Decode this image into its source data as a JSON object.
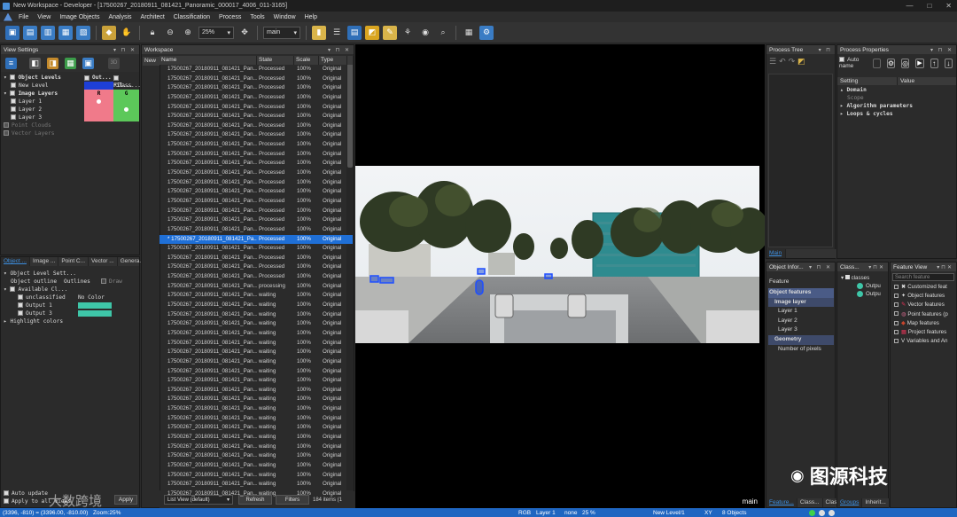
{
  "window": {
    "title": "New Workspace - Developer - [17500267_20180911_081421_Panoramic_000017_4006_011-3165]",
    "buttons": [
      "—",
      "□",
      "✕"
    ]
  },
  "menu": [
    "File",
    "View",
    "Image Objects",
    "Analysis",
    "Architect",
    "Classification",
    "Process",
    "Tools",
    "Window",
    "Help"
  ],
  "toolbar": {
    "zoom": "25%",
    "map": "main"
  },
  "view_settings": {
    "title": "View Settings",
    "tree": [
      {
        "label": "Object Levels",
        "bold": true,
        "indent": 0
      },
      {
        "label": "New Level",
        "bold": false,
        "indent": 1
      },
      {
        "label": "Image Layers",
        "bold": true,
        "indent": 0
      },
      {
        "label": "Layer 1",
        "bold": false,
        "indent": 1
      },
      {
        "label": "Layer 2",
        "bold": false,
        "indent": 1
      },
      {
        "label": "Layer 3",
        "bold": false,
        "indent": 1
      },
      {
        "label": "Point Clouds",
        "bold": false,
        "indent": 0,
        "dim": true
      },
      {
        "label": "Vector Layers",
        "bold": false,
        "indent": 0,
        "dim": true
      }
    ],
    "col_headers": [
      "Out...",
      "Fil..."
    ],
    "class_label": "Class...",
    "layer_r": "R",
    "layer_g": "G",
    "badge": "3D"
  },
  "lower_tabs": [
    "Object ...",
    "Image ...",
    "Point C...",
    "Vector ...",
    "Genera..."
  ],
  "object_level_settings": {
    "title": "Object Level Sett...",
    "outline_label": "Object outline",
    "outlines": "Outlines",
    "draw": "Draw",
    "available": "Available Cl...",
    "classes": [
      {
        "label": "unclassified",
        "color_label": "No Color",
        "color": ""
      },
      {
        "label": "Output 1",
        "color_label": "",
        "color": "#3ec6a8"
      },
      {
        "label": "Output 3",
        "color_label": "",
        "color": "#3ec6a8"
      }
    ],
    "highlight": "Highlight colors",
    "auto_update": "Auto update",
    "apply_all": "Apply to all views",
    "apply": "Apply"
  },
  "workspace": {
    "title": "Workspace",
    "root": "New",
    "columns": [
      "Name",
      "State",
      "Scale",
      "Type"
    ],
    "rows": [
      {
        "name": "17500267_20180911_081421_Pan...",
        "state": "Processed",
        "scale": "100%",
        "type": "Original"
      },
      {
        "name": "17500267_20180911_081421_Pan...",
        "state": "Processed",
        "scale": "100%",
        "type": "Original"
      },
      {
        "name": "17500267_20180911_081421_Pan...",
        "state": "Processed",
        "scale": "100%",
        "type": "Original"
      },
      {
        "name": "17500267_20180911_081421_Pan...",
        "state": "Processed",
        "scale": "100%",
        "type": "Original"
      },
      {
        "name": "17500267_20180911_081421_Pan...",
        "state": "Processed",
        "scale": "100%",
        "type": "Original"
      },
      {
        "name": "17500267_20180911_081421_Pan...",
        "state": "Processed",
        "scale": "100%",
        "type": "Original"
      },
      {
        "name": "17500267_20180911_081421_Pan...",
        "state": "Processed",
        "scale": "100%",
        "type": "Original"
      },
      {
        "name": "17500267_20180911_081421_Pan...",
        "state": "Processed",
        "scale": "100%",
        "type": "Original"
      },
      {
        "name": "17500267_20180911_081421_Pan...",
        "state": "Processed",
        "scale": "100%",
        "type": "Original"
      },
      {
        "name": "17500267_20180911_081421_Pan...",
        "state": "Processed",
        "scale": "100%",
        "type": "Original"
      },
      {
        "name": "17500267_20180911_081421_Pan...",
        "state": "Processed",
        "scale": "100%",
        "type": "Original"
      },
      {
        "name": "17500267_20180911_081421_Pan...",
        "state": "Processed",
        "scale": "100%",
        "type": "Original"
      },
      {
        "name": "17500267_20180911_081421_Pan...",
        "state": "Processed",
        "scale": "100%",
        "type": "Original"
      },
      {
        "name": "17500267_20180911_081421_Pan...",
        "state": "Processed",
        "scale": "100%",
        "type": "Original"
      },
      {
        "name": "17500267_20180911_081421_Pan...",
        "state": "Processed",
        "scale": "100%",
        "type": "Original"
      },
      {
        "name": "17500267_20180911_081421_Pan...",
        "state": "Processed",
        "scale": "100%",
        "type": "Original"
      },
      {
        "name": "17500267_20180911_081421_Pan...",
        "state": "Processed",
        "scale": "100%",
        "type": "Original"
      },
      {
        "name": "17500267_20180911_081421_Pan...",
        "state": "Processed",
        "scale": "100%",
        "type": "Original"
      },
      {
        "name": "* 17500267_20180911_081421_Pa...",
        "state": "Processed",
        "scale": "100%",
        "type": "Original",
        "selected": true
      },
      {
        "name": "17500267_20180911_081421_Pan...",
        "state": "Processed",
        "scale": "100%",
        "type": "Original"
      },
      {
        "name": "17500267_20180911_081421_Pan...",
        "state": "Processed",
        "scale": "100%",
        "type": "Original"
      },
      {
        "name": "17500267_20180911_081421_Pan...",
        "state": "Processed",
        "scale": "100%",
        "type": "Original"
      },
      {
        "name": "17500267_20180911_081421_Pan...",
        "state": "Processed",
        "scale": "100%",
        "type": "Original"
      },
      {
        "name": "17500267_20180911_081421_Pan...",
        "state": "processing",
        "scale": "100%",
        "type": "Original"
      },
      {
        "name": "17500267_20180911_081421_Pan...",
        "state": "waiting",
        "scale": "100%",
        "type": "Original"
      },
      {
        "name": "17500267_20180911_081421_Pan...",
        "state": "waiting",
        "scale": "100%",
        "type": "Original"
      },
      {
        "name": "17500267_20180911_081421_Pan...",
        "state": "waiting",
        "scale": "100%",
        "type": "Original"
      },
      {
        "name": "17500267_20180911_081421_Pan...",
        "state": "waiting",
        "scale": "100%",
        "type": "Original"
      },
      {
        "name": "17500267_20180911_081421_Pan...",
        "state": "waiting",
        "scale": "100%",
        "type": "Original"
      },
      {
        "name": "17500267_20180911_081421_Pan...",
        "state": "waiting",
        "scale": "100%",
        "type": "Original"
      },
      {
        "name": "17500267_20180911_081421_Pan...",
        "state": "waiting",
        "scale": "100%",
        "type": "Original"
      },
      {
        "name": "17500267_20180911_081421_Pan...",
        "state": "waiting",
        "scale": "100%",
        "type": "Original"
      },
      {
        "name": "17500267_20180911_081421_Pan...",
        "state": "waiting",
        "scale": "100%",
        "type": "Original"
      },
      {
        "name": "17500267_20180911_081421_Pan...",
        "state": "waiting",
        "scale": "100%",
        "type": "Original"
      },
      {
        "name": "17500267_20180911_081421_Pan...",
        "state": "waiting",
        "scale": "100%",
        "type": "Original"
      },
      {
        "name": "17500267_20180911_081421_Pan...",
        "state": "waiting",
        "scale": "100%",
        "type": "Original"
      },
      {
        "name": "17500267_20180911_081421_Pan...",
        "state": "waiting",
        "scale": "100%",
        "type": "Original"
      },
      {
        "name": "17500267_20180911_081421_Pan...",
        "state": "waiting",
        "scale": "100%",
        "type": "Original"
      },
      {
        "name": "17500267_20180911_081421_Pan...",
        "state": "waiting",
        "scale": "100%",
        "type": "Original"
      },
      {
        "name": "17500267_20180911_081421_Pan...",
        "state": "waiting",
        "scale": "100%",
        "type": "Original"
      },
      {
        "name": "17500267_20180911_081421_Pan...",
        "state": "waiting",
        "scale": "100%",
        "type": "Original"
      },
      {
        "name": "17500267_20180911_081421_Pan...",
        "state": "waiting",
        "scale": "100%",
        "type": "Original"
      },
      {
        "name": "17500267_20180911_081421_Pan...",
        "state": "waiting",
        "scale": "100%",
        "type": "Original"
      },
      {
        "name": "17500267_20180911_081421_Pan...",
        "state": "waiting",
        "scale": "100%",
        "type": "Original"
      },
      {
        "name": "17500267_20180911_081421_Pan...",
        "state": "waiting",
        "scale": "100%",
        "type": "Original"
      },
      {
        "name": "17500267_20180911_081421_Pan...",
        "state": "waiting",
        "scale": "100%",
        "type": "Original"
      }
    ],
    "view_mode": "List View (default)",
    "refresh": "Refresh",
    "filters": "Filters",
    "count": "184 items (1"
  },
  "viewer": {
    "label": "main"
  },
  "process_tree": {
    "title": "Process Tree",
    "tab": "Main"
  },
  "process_properties": {
    "title": "Process Properties",
    "auto_name": "Auto name",
    "col_setting": "Setting",
    "col_value": "Value",
    "items": [
      "Domain",
      "Scope",
      "Algorithm parameters",
      "Loops & cycles"
    ]
  },
  "object_info": {
    "title": "Object Infor...",
    "header": "Feature",
    "items": [
      {
        "label": "Object features",
        "style": "section"
      },
      {
        "label": "Image layer",
        "style": "section2"
      },
      {
        "label": "Layer 1",
        "style": "item"
      },
      {
        "label": "Layer 2",
        "style": "item"
      },
      {
        "label": "Layer 3",
        "style": "item"
      },
      {
        "label": "Geometry",
        "style": "section2"
      },
      {
        "label": "Number of pixels",
        "style": "item"
      }
    ],
    "tabs": [
      "Feature...",
      "Class...",
      "Class..."
    ]
  },
  "class_hierarchy": {
    "title": "Class...",
    "root": "classes",
    "items": [
      "Outpu",
      "Outpu"
    ],
    "tabs": [
      "Groups",
      "Inherit..."
    ]
  },
  "feature_view": {
    "title": "Feature View",
    "search": "Search feature",
    "items": [
      "Customized feat",
      "Object features",
      "Vector features",
      "Point features (p",
      "Map features",
      "Project features",
      "Variables and An"
    ]
  },
  "status": {
    "coords": "(3396, -810) = (3396.00, -810.00)",
    "zoom": "Zoom:25%",
    "mode": "RGB",
    "layer": "Layer 1",
    "none": "none",
    "pct": "25 %",
    "level": "New Level/1",
    "xy": "XY",
    "objects": "8 Objects"
  },
  "watermarks": {
    "left": "大数跨境",
    "right": "图源科技"
  }
}
